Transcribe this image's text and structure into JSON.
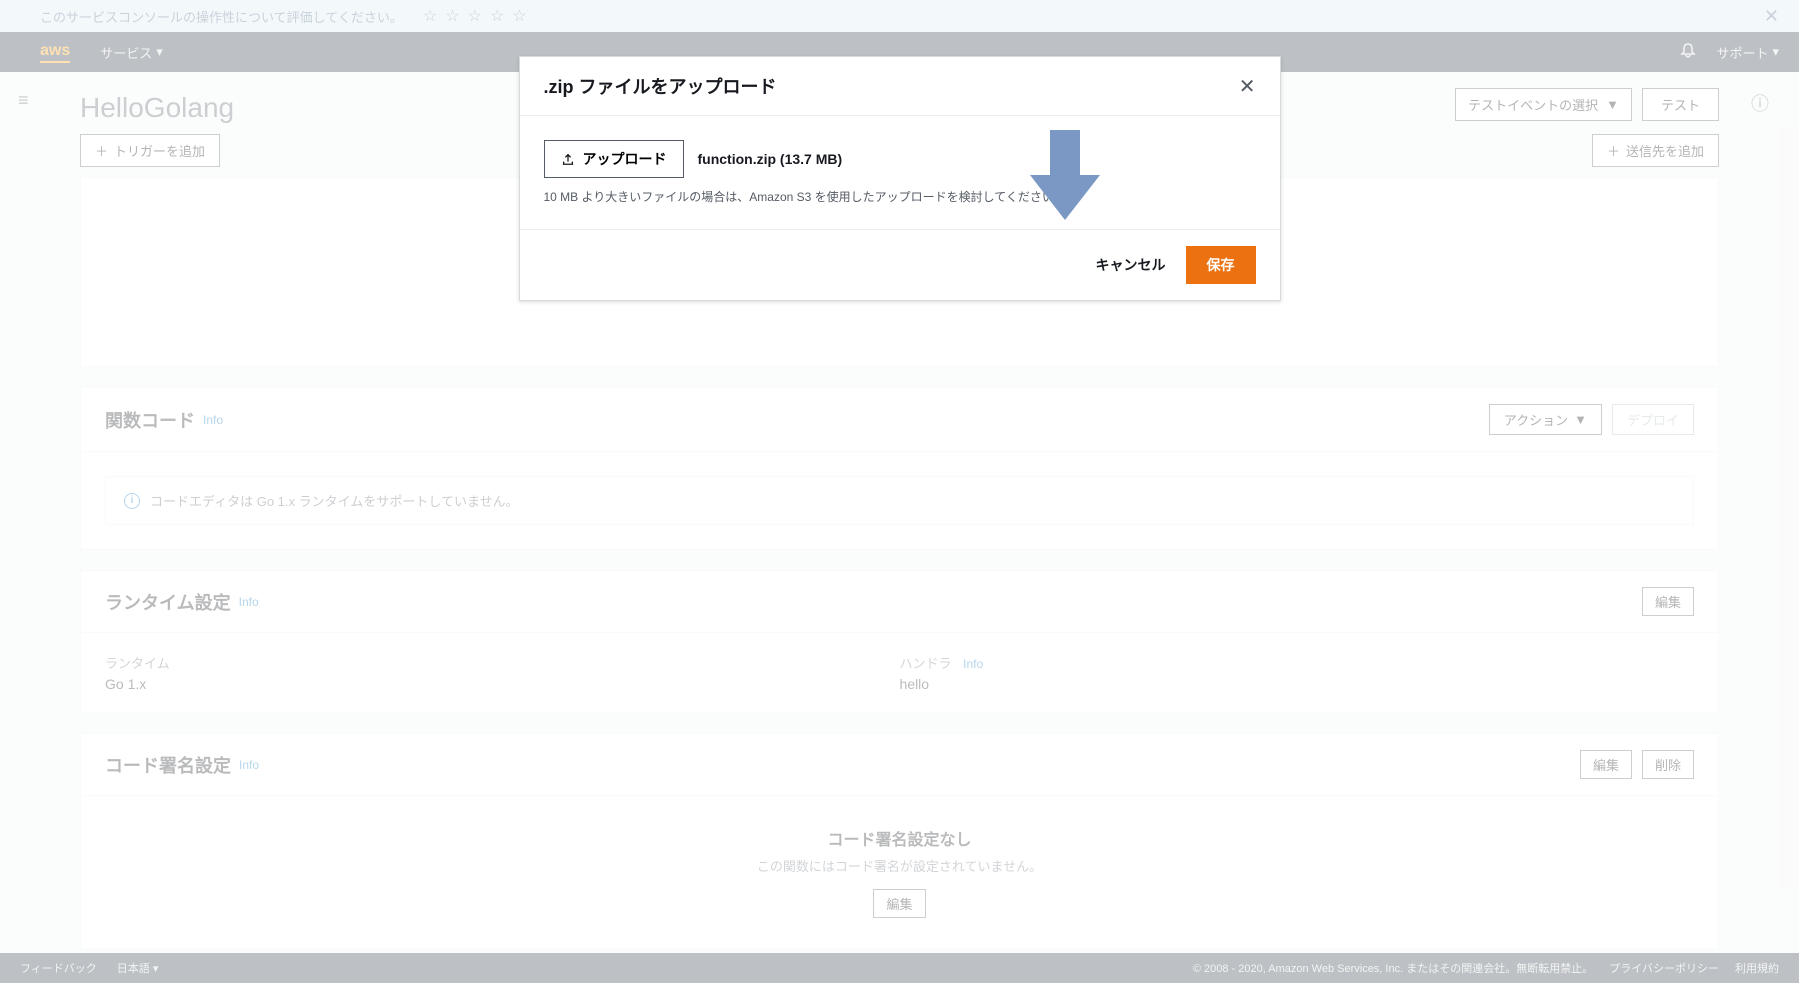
{
  "feedback": {
    "text": "このサービスコンソールの操作性について評価してください。",
    "close_label": "✕"
  },
  "topnav": {
    "logo": "aws",
    "services_label": "サービス",
    "support_label": "サポート"
  },
  "page": {
    "title": "HelloGolang",
    "test_event_select": "テストイベントの選択",
    "test_btn": "テスト",
    "add_trigger": "トリガーを追加",
    "add_destination": "送信先を追加"
  },
  "function_code": {
    "title": "関数コード",
    "info": "Info",
    "action_btn": "アクション",
    "deploy_btn": "デプロイ",
    "notice": "コードエディタは Go 1.x ランタイムをサポートしていません。"
  },
  "runtime": {
    "title": "ランタイム設定",
    "info": "Info",
    "edit_btn": "編集",
    "runtime_label": "ランタイム",
    "runtime_value": "Go 1.x",
    "handler_label": "ハンドラ",
    "handler_info": "Info",
    "handler_value": "hello"
  },
  "signing": {
    "title": "コード署名設定",
    "info": "Info",
    "edit_btn": "編集",
    "delete_btn": "削除",
    "none_title": "コード署名設定なし",
    "none_sub": "この関数にはコード署名が設定されていません。",
    "edit_center_btn": "編集"
  },
  "modal": {
    "title": ".zip ファイルをアップロード",
    "upload_btn": "アップロード",
    "file_name": "function.zip (13.7 MB)",
    "hint": "10 MB より大きいファイルの場合は、Amazon S3 を使用したアップロードを検討してください。",
    "cancel": "キャンセル",
    "save": "保存"
  },
  "footer": {
    "feedback": "フィードバック",
    "language": "日本語",
    "copyright": "© 2008 - 2020, Amazon Web Services, Inc. またはその関連会社。無断転用禁止。",
    "privacy": "プライバシーポリシー",
    "terms": "利用規約"
  }
}
